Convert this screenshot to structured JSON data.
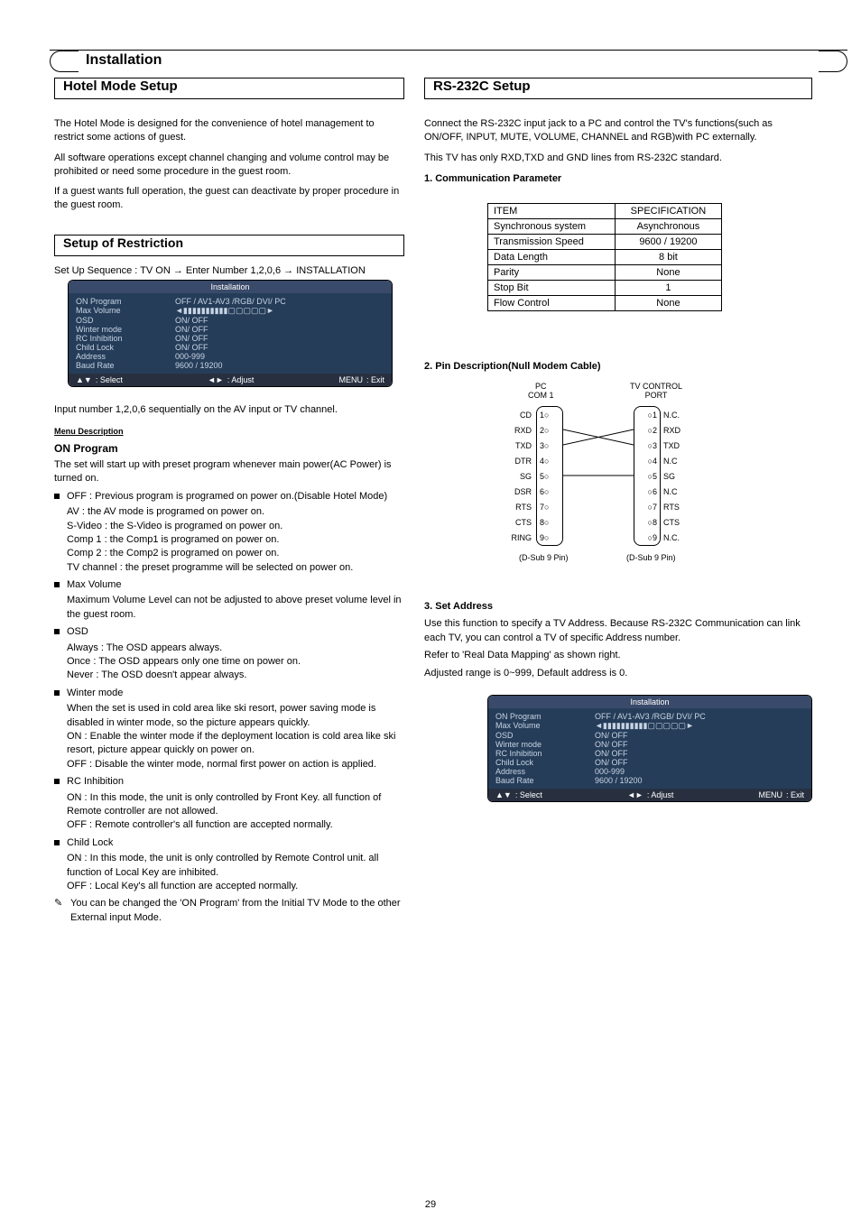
{
  "page_title": "Installation",
  "left_section_title": "Hotel Mode Setup",
  "right_section_title": "RS-232C Setup",
  "left_intro_p1": "The Hotel Mode is designed for the convenience of hotel management to restrict some actions of guest.",
  "left_intro_p2": "All software operations except channel changing and volume control may be prohibited or need some procedure in the guest room.",
  "left_intro_p3": "If a guest wants full operation, the guest can deactivate by proper procedure in the guest room.",
  "setup_title": "Setup of Restriction",
  "setup_seq": "Set Up Sequence : TV ON → Enter Number 1,2,0,6 → INSTALLATION",
  "osd": {
    "header": "Installation",
    "rows": [
      {
        "label": "ON Program",
        "value": "OFF / AV1-AV3 /RGB/ DVI/ PC"
      },
      {
        "label": "Max Volume",
        "value": "◄▮▮▮▮▮▮▮▮▮▮▢▢▢▢▢►"
      },
      {
        "label": "OSD",
        "value": "ON/ OFF"
      },
      {
        "label": "Winter mode",
        "value": "ON/ OFF"
      },
      {
        "label": "RC Inhibition",
        "value": "ON/ OFF"
      },
      {
        "label": "Child Lock",
        "value": "ON/ OFF"
      },
      {
        "label": "Address",
        "value": "000-999"
      },
      {
        "label": "Baud Rate",
        "value": "9600 / 19200"
      }
    ],
    "foot_select": ": Select",
    "foot_adjust": ": Adjust",
    "foot_exit": ": Exit",
    "foot_menu": "MENU"
  },
  "left_body": {
    "note_sequence": "Input number 1,2,0,6 sequentially on the AV input or TV channel.",
    "menu_desc_title": "Menu Description",
    "on_program": {
      "title": "ON Program",
      "p1": "The set will start up with preset program whenever main power(AC Power) is turned on.",
      "p": [
        "OFF : Previous program is programed on power on.(Disable Hotel Mode)",
        "AV : the AV mode is programed on power on.",
        "S-Video : the S-Video is programed on power on.",
        "Comp 1 : the Comp1 is programed on power on.",
        "Comp 2 : the Comp2 is programed on power on.",
        "TV channel : the preset programme will be selected on power on."
      ]
    },
    "max_volume": {
      "title": "Max Volume",
      "desc": "Maximum Volume Level can not be adjusted to above preset volume level in the guest room."
    },
    "osd_item": {
      "title": "OSD",
      "p": [
        "Always : The OSD appears always.",
        "Once : The OSD appears only one time on power on.",
        "Never : The OSD doesn't appear always."
      ]
    },
    "winter": {
      "title": "Winter mode",
      "p1": "When the set is used in cold area like ski resort, power saving mode is disabled in winter mode, so the picture appears quickly.",
      "on": "ON : Enable the winter mode if the deployment location is cold area like ski resort, picture appear quickly on power on.",
      "off": "OFF : Disable the winter mode, normal first power on action is applied."
    },
    "rc": {
      "title": "RC Inhibition",
      "on": "ON : In this mode, the unit is only controlled by Front Key. all function of Remote controller are not allowed.",
      "off": "OFF : Remote controller's all function are accepted normally."
    },
    "child": {
      "title": "Child Lock",
      "on": "ON : In this mode, the unit is only controlled by Remote Control unit. all function of Local Key are inhibited.",
      "off": "OFF : Local Key's all function are accepted normally."
    },
    "note_final": "You can be changed the 'ON Program' from the Initial TV Mode to the other External input Mode."
  },
  "right": {
    "intro1": "Connect the RS-232C input jack to a PC and control the TV's functions(such as ON/OFF, INPUT, MUTE, VOLUME, CHANNEL and RGB)with PC externally.",
    "intro2": "This TV has only RXD,TXD and GND lines from RS-232C standard.",
    "comm_title": "1. Communication Parameter",
    "spec": {
      "h1": "ITEM",
      "h2": "SPECIFICATION",
      "rows": [
        {
          "a": "Synchronous system",
          "b": "Asynchronous"
        },
        {
          "a": "Transmission Speed",
          "b": "9600 / 19200"
        },
        {
          "a": "Data Length",
          "b": "8 bit"
        },
        {
          "a": "Parity",
          "b": "None"
        },
        {
          "a": "Stop Bit",
          "b": "1"
        },
        {
          "a": "Flow Control",
          "b": "None"
        }
      ]
    },
    "pin_title": "2. Pin Description(Null Modem Cable)",
    "pc_col_title": "PC\nCOM 1",
    "tv_col_title": "TV CONTROL\nPORT",
    "pc_labels": [
      "CD",
      "RXD",
      "TXD",
      "DTR",
      "SG",
      "DSR",
      "RTS",
      "CTS",
      "RING"
    ],
    "pins": [
      "1",
      "2",
      "3",
      "4",
      "5",
      "6",
      "7",
      "8",
      "9"
    ],
    "tv_labels": [
      "N.C.",
      "RXD",
      "TXD",
      "N.C",
      "SG",
      "N.C",
      "RTS",
      "CTS",
      "N.C."
    ],
    "dsub": "(D-Sub   9 Pin)",
    "set_addr_title": "3. Set Address",
    "set_addr_p1": "Use this function to specify a TV Address. Because RS-232C Communication can link each TV, you can control a TV of specific Address number.",
    "set_addr_p2": "Refer to 'Real Data Mapping' as shown right.",
    "set_addr_p3": "Adjusted range is 0~999, Default address is 0."
  },
  "page_number": "29"
}
